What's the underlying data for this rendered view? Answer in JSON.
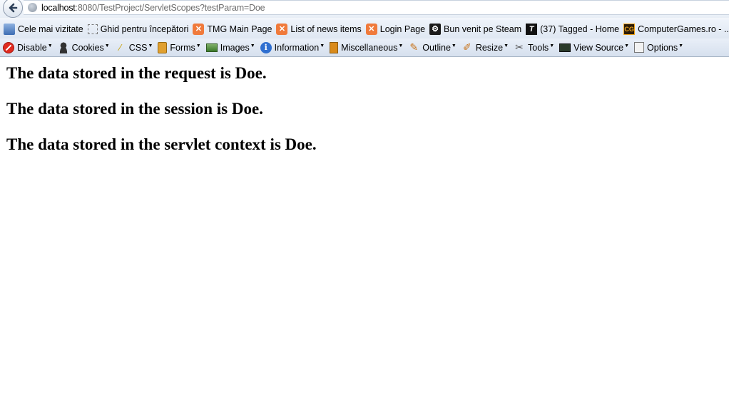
{
  "browser": {
    "url_host": "localhost",
    "url_rest": ":8080/TestProject/ServletScopes?testParam=Doe"
  },
  "bookmarks": [
    {
      "label": "Cele mai vizitate",
      "icon": "blue-doc-icon"
    },
    {
      "label": "Ghid pentru începători",
      "icon": "dotted-page-icon"
    },
    {
      "label": "TMG Main Page",
      "icon": "xampp-icon"
    },
    {
      "label": "List of news items",
      "icon": "xampp-icon"
    },
    {
      "label": "Login Page",
      "icon": "xampp-icon"
    },
    {
      "label": "Bun venit pe Steam",
      "icon": "steam-icon"
    },
    {
      "label": "(37) Tagged - Home",
      "icon": "tagged-icon"
    },
    {
      "label": "ComputerGames.ro - ...",
      "icon": "computergames-icon"
    }
  ],
  "devtools": [
    {
      "label": "Disable",
      "icon": "disable-icon"
    },
    {
      "label": "Cookies",
      "icon": "cookies-icon"
    },
    {
      "label": "CSS",
      "icon": "css-wand-icon"
    },
    {
      "label": "Forms",
      "icon": "forms-icon"
    },
    {
      "label": "Images",
      "icon": "images-icon"
    },
    {
      "label": "Information",
      "icon": "info-icon"
    },
    {
      "label": "Miscellaneous",
      "icon": "misc-icon"
    },
    {
      "label": "Outline",
      "icon": "outline-pencil-icon"
    },
    {
      "label": "Resize",
      "icon": "resize-ruler-icon"
    },
    {
      "label": "Tools",
      "icon": "tools-icon"
    },
    {
      "label": "View Source",
      "icon": "view-source-icon"
    },
    {
      "label": "Options",
      "icon": "options-icon"
    }
  ],
  "page": {
    "lines": [
      "The data stored in the request is Doe.",
      "The data stored in the session is Doe.",
      "The data stored in the servlet context is Doe."
    ]
  }
}
